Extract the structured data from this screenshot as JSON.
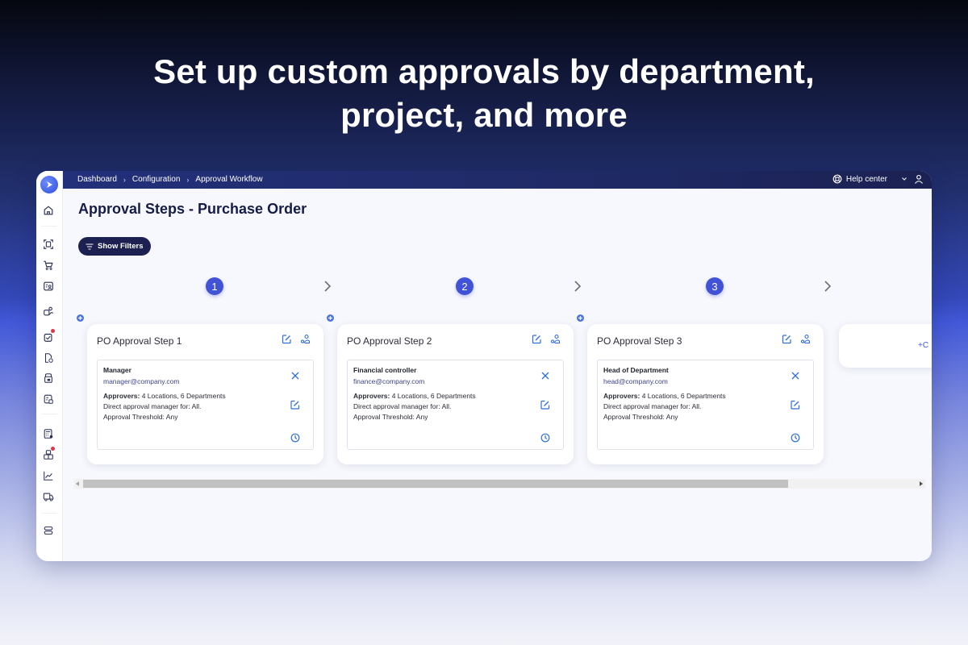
{
  "headline": {
    "line1": "Set up custom approvals by department,",
    "line2": "project, and more"
  },
  "topbar": {
    "breadcrumbs": [
      "Dashboard",
      "Configuration",
      "Approval Workflow"
    ],
    "help_label": "Help center"
  },
  "sidebar": {
    "items": [
      {
        "icon": "home-icon"
      },
      {
        "icon": "scan-document-icon"
      },
      {
        "icon": "cart-icon"
      },
      {
        "icon": "contact-card-icon"
      },
      {
        "icon": "team-icon"
      },
      {
        "icon": "approval-task-icon",
        "notification": true
      },
      {
        "icon": "document-check-icon"
      },
      {
        "icon": "locked-folder-icon"
      },
      {
        "icon": "invoice-icon"
      },
      {
        "icon": "calculator-icon"
      },
      {
        "icon": "inventory-boxes-icon",
        "notification": true
      },
      {
        "icon": "analytics-chart-icon"
      },
      {
        "icon": "delivery-truck-icon"
      },
      {
        "icon": "database-icon"
      }
    ]
  },
  "page": {
    "title": "Approval Steps - Purchase Order",
    "filters_label": "Show Filters"
  },
  "steps": [
    {
      "number": "1",
      "title": "PO Approval Step 1",
      "approver": {
        "name": "Manager",
        "email": "manager@company.com",
        "approvers_label": "Approvers:",
        "approvers_value": "4 Locations, 6 Departments",
        "direct": "Direct approval manager for: All.",
        "threshold": "Approval Threshold: Any"
      }
    },
    {
      "number": "2",
      "title": "PO Approval Step 2",
      "approver": {
        "name": "Financial controller",
        "email": "finance@company.com",
        "approvers_label": "Approvers:",
        "approvers_value": "4 Locations, 6 Departments",
        "direct": "Direct approval manager for: All.",
        "threshold": "Approval Threshold: Any"
      }
    },
    {
      "number": "3",
      "title": "PO Approval Step 3",
      "approver": {
        "name": "Head of Department",
        "email": "head@company.com",
        "approvers_label": "Approvers:",
        "approvers_value": "4 Locations, 6 Departments",
        "direct": "Direct approval manager for: All.",
        "threshold": "Approval Threshold: Any"
      }
    }
  ],
  "add_card": {
    "label": "+C"
  },
  "scroll": {
    "position_fraction": 0.0,
    "visible_fraction": 0.84
  },
  "colors": {
    "accent": "#4152d6",
    "nav_dark": "#1c2152",
    "icon_blue": "#2f6fd6"
  }
}
